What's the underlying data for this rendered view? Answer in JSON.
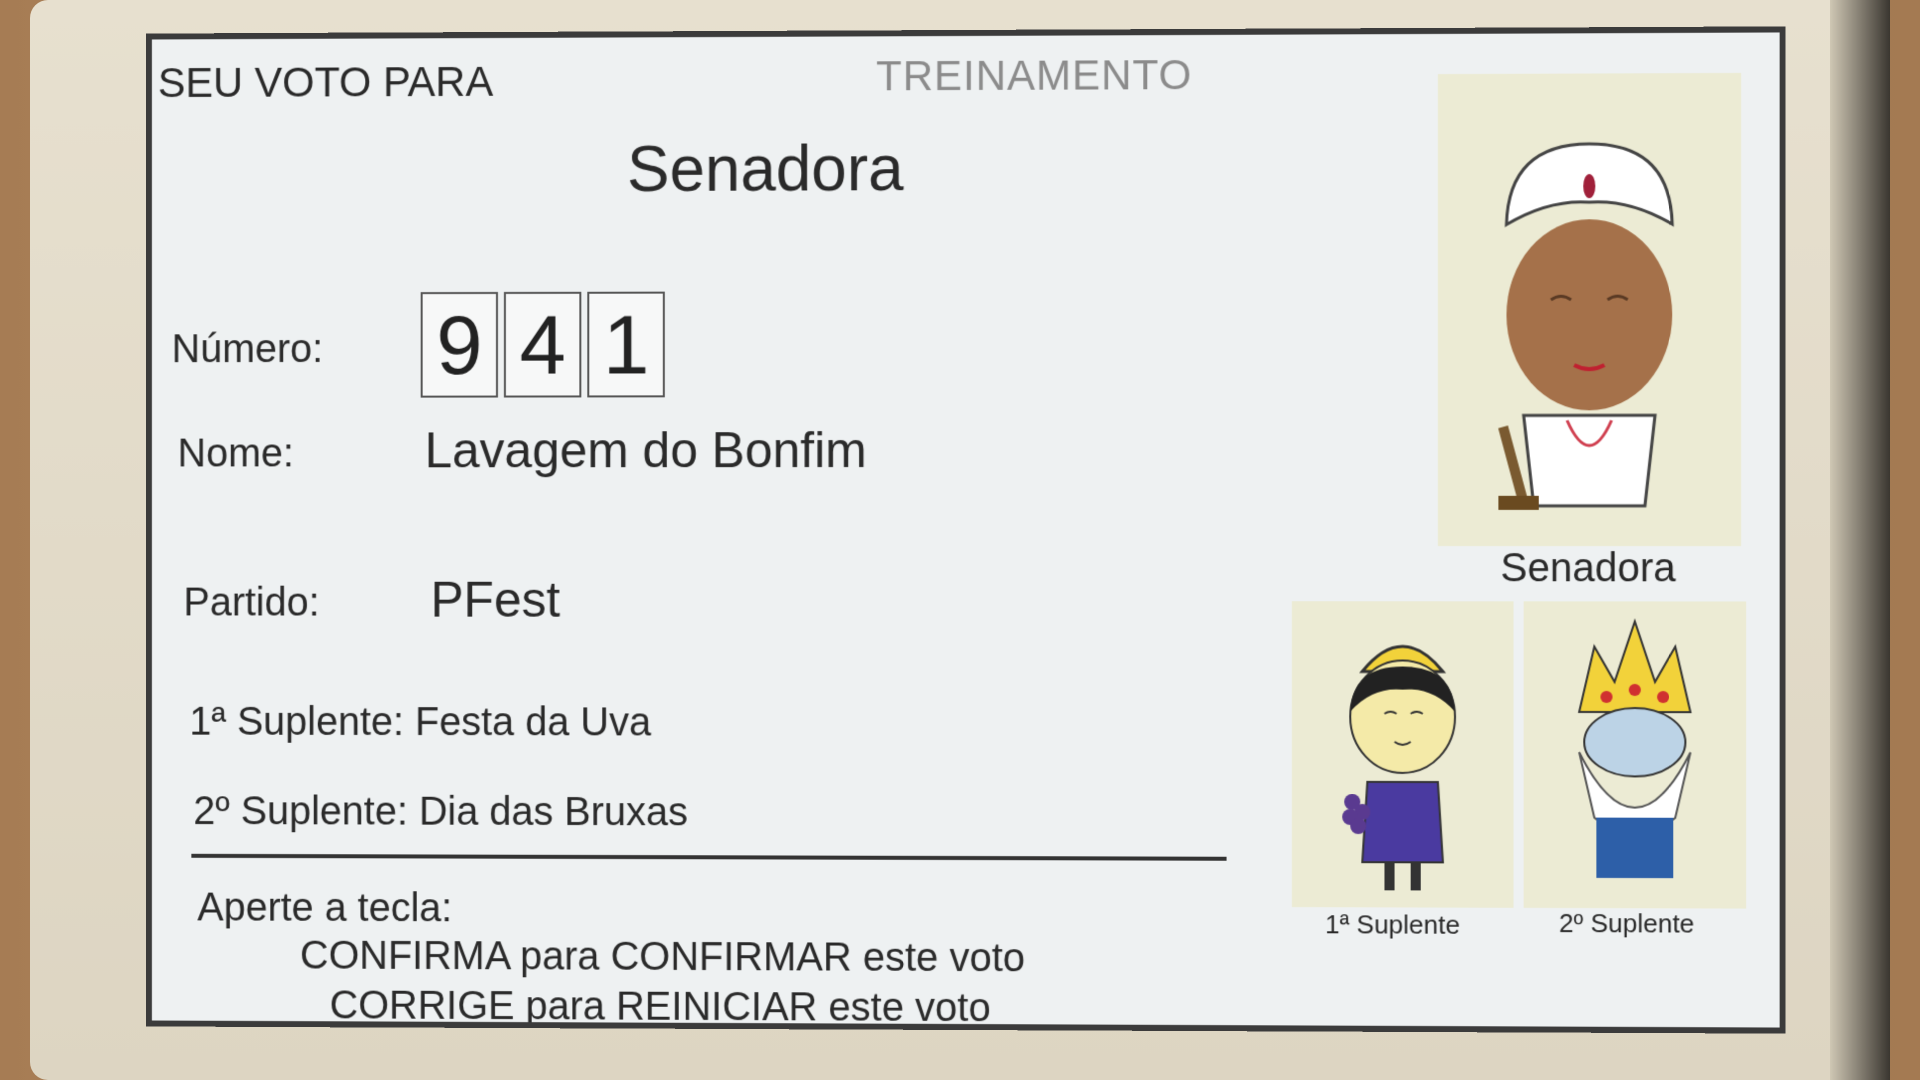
{
  "header": {
    "left": "SEU VOTO PARA",
    "center": "TREINAMENTO"
  },
  "office_title": "Senadora",
  "fields": {
    "numero_label": "Número:",
    "numero_digits": [
      "9",
      "4",
      "1"
    ],
    "nome_label": "Nome:",
    "nome_value": "Lavagem do Bonfim",
    "partido_label": "Partido:",
    "partido_value": "PFest",
    "suplente1_label": "1ª Suplente:",
    "suplente1_value": "Festa da Uva",
    "suplente2_label": "2º Suplente:",
    "suplente2_value": "Dia das Bruxas"
  },
  "instructions": {
    "title": "Aperte a tecla:",
    "line1": "CONFIRMA para CONFIRMAR este voto",
    "line2": "CORRIGE para REINICIAR este voto"
  },
  "photos": {
    "main_caption": "Senadora",
    "suplente1_caption": "1ª Suplente",
    "suplente2_caption": "2º Suplente",
    "main_icon": "baiana-portrait-icon",
    "suplente1_icon": "grape-festival-portrait-icon",
    "suplente2_icon": "crowned-wizard-portrait-icon"
  }
}
